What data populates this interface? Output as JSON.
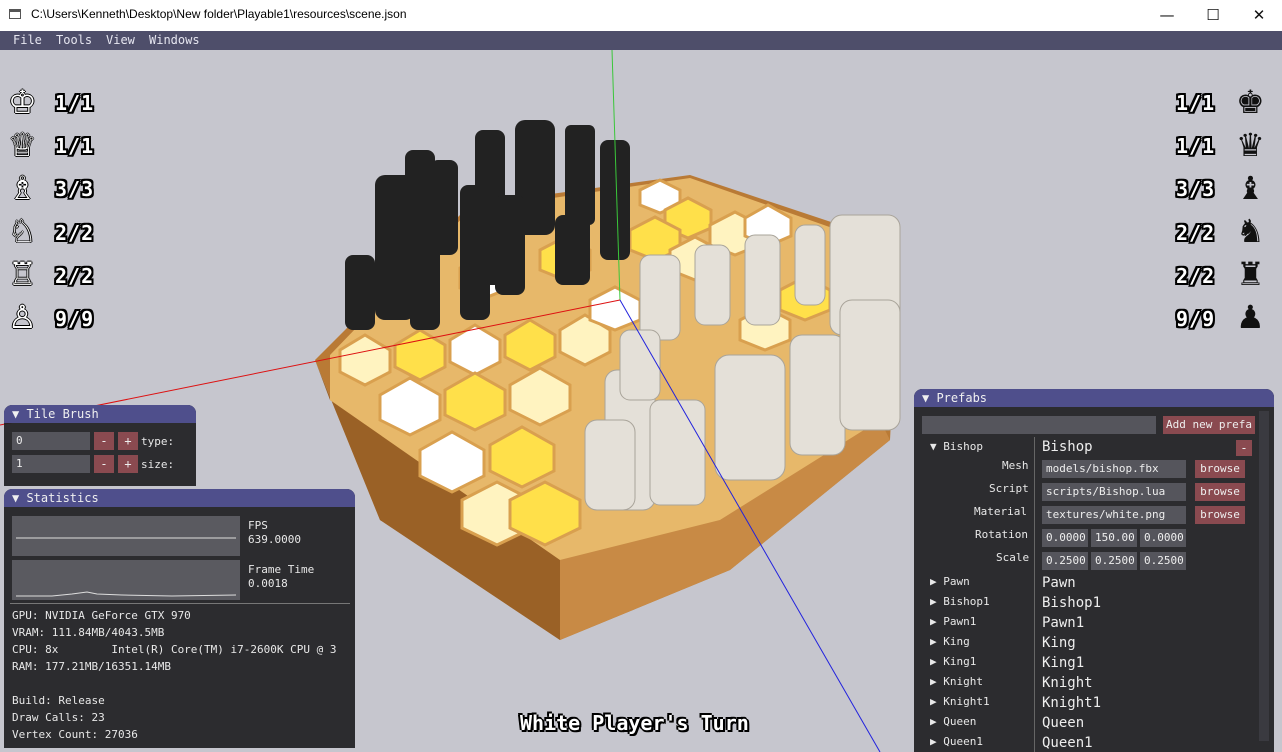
{
  "window": {
    "title": "C:\\Users\\Kenneth\\Desktop\\New folder\\Playable1\\resources\\scene.json",
    "minimize": "—",
    "maximize": "☐",
    "close": "✕"
  },
  "menu": [
    "File",
    "Tools",
    "View",
    "Windows"
  ],
  "hud": {
    "white": [
      {
        "icon": "♔",
        "label": "1/1"
      },
      {
        "icon": "♕",
        "label": "1/1"
      },
      {
        "icon": "♗",
        "label": "3/3"
      },
      {
        "icon": "♘",
        "label": "2/2"
      },
      {
        "icon": "♖",
        "label": "2/2"
      },
      {
        "icon": "♙",
        "label": "9/9"
      }
    ],
    "black": [
      {
        "icon": "♚",
        "label": "1/1"
      },
      {
        "icon": "♛",
        "label": "1/1"
      },
      {
        "icon": "♝",
        "label": "3/3"
      },
      {
        "icon": "♞",
        "label": "2/2"
      },
      {
        "icon": "♜",
        "label": "2/2"
      },
      {
        "icon": "♟",
        "label": "9/9"
      }
    ],
    "turn": "White Player's Turn"
  },
  "tile_brush": {
    "title": "Tile Brush",
    "type_value": "0",
    "size_value": "1",
    "minus": "-",
    "plus": "+",
    "type_label": "type:",
    "size_label": "size:"
  },
  "statistics": {
    "title": "Statistics",
    "fps_label": "FPS",
    "fps_value": "639.0000",
    "frame_label": "Frame Time",
    "frame_value": "0.0018",
    "gpu": "GPU: NVIDIA GeForce GTX 970",
    "vram": "VRAM: 111.84MB/4043.5MB",
    "cpu": "CPU: 8x        Intel(R) Core(TM) i7-2600K CPU @ 3",
    "ram": "RAM: 177.21MB/16351.14MB",
    "build": "Build: Release",
    "draw_calls": "Draw Calls: 23",
    "vertex_count": "Vertex Count: 27036"
  },
  "prefabs": {
    "title": "Prefabs",
    "search_value": "",
    "add_button": "Add new prefa",
    "selected": "Bishop",
    "remove": "-",
    "fields": {
      "mesh_label": "Mesh",
      "mesh": "models/bishop.fbx",
      "script_label": "Script",
      "script": "scripts/Bishop.lua",
      "material_label": "Material",
      "material": "textures/white.png",
      "rotation_label": "Rotation",
      "rotation": [
        "0.0000",
        "150.00",
        "0.0000"
      ],
      "scale_label": "Scale",
      "scale": [
        "0.2500",
        "0.2500",
        "0.2500"
      ],
      "browse": "browse"
    },
    "list": [
      "Pawn",
      "Bishop1",
      "Pawn1",
      "King",
      "King1",
      "Knight",
      "Knight1",
      "Queen",
      "Queen1"
    ]
  }
}
